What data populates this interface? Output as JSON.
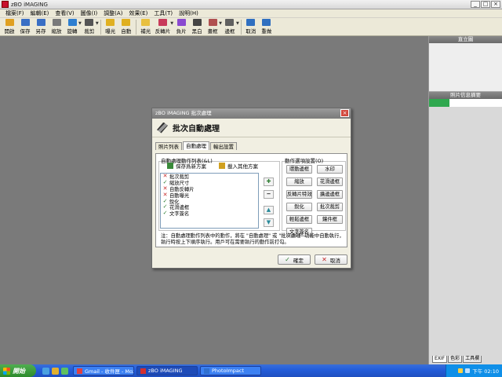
{
  "app": {
    "title": "zBO iMAGING",
    "window_buttons": [
      "_",
      "□",
      "×"
    ]
  },
  "menu": [
    "檔案(F)",
    "編輯(E)",
    "查看(V)",
    "圖像(I)",
    "調整(A)",
    "效果(E)",
    "工具(T)",
    "說明(H)"
  ],
  "toolbar": [
    {
      "label": "開啟",
      "icon": "folder-open-icon",
      "color": "#e0a020"
    },
    {
      "label": "保存",
      "icon": "save-icon",
      "color": "#3a6fc4"
    },
    {
      "label": "另存",
      "icon": "save-as-icon",
      "color": "#3a6fc4"
    },
    {
      "label": "縮放",
      "icon": "zoom-icon",
      "color": "#7a7a7a"
    },
    {
      "label": "旋轉",
      "icon": "rotate-icon",
      "color": "#2f7fd0",
      "dropdown": true
    },
    {
      "label": "裁剪",
      "icon": "crop-icon",
      "color": "#555555",
      "dropdown": true
    },
    {
      "label": "曝光",
      "icon": "exposure-icon",
      "color": "#e0b020"
    },
    {
      "label": "自動",
      "icon": "auto-icon",
      "color": "#e0b020"
    },
    {
      "label": "補光",
      "icon": "fill-light-icon",
      "color": "#e8c040"
    },
    {
      "label": "反轉片",
      "icon": "slide-film-icon",
      "color": "#c83a5a",
      "dropdown": true
    },
    {
      "label": "負片",
      "icon": "negative-icon",
      "color": "#8a4ad0"
    },
    {
      "label": "黑白",
      "icon": "black-white-icon",
      "color": "#444444"
    },
    {
      "label": "畫框",
      "icon": "frame-icon",
      "color": "#b05050",
      "dropdown": true
    },
    {
      "label": "邊框",
      "icon": "border-icon",
      "color": "#606060",
      "dropdown": true
    },
    {
      "label": "取消",
      "icon": "undo-icon",
      "color": "#2f6fc0"
    },
    {
      "label": "重做",
      "icon": "redo-icon",
      "color": "#2f6fc0"
    }
  ],
  "right_panel": {
    "histogram_title": "直立圖",
    "info_title": "照片信息摘要",
    "tabs": [
      "EXIF",
      "色彩",
      "工具欄"
    ]
  },
  "dialog": {
    "title": "zBO iMAGING 批次處理",
    "heading": "批次自動處理",
    "tabs": [
      "照片列表",
      "自動處理",
      "輸出設置"
    ],
    "active_tab_index": 1,
    "list_group_label": "自動處理動作列表(&L)",
    "save_scheme": "保存爲新方案",
    "load_scheme": "載入其他方案",
    "actions_list": [
      {
        "label": "批次裁剪",
        "enabled": false
      },
      {
        "label": "縮放尺寸",
        "enabled": true
      },
      {
        "label": "自動反轉片",
        "enabled": false
      },
      {
        "label": "自動曝光",
        "enabled": false
      },
      {
        "label": "銳化",
        "enabled": true
      },
      {
        "label": "花滑邊框",
        "enabled": true
      },
      {
        "label": "文字簽名",
        "enabled": true
      }
    ],
    "side_buttons": [
      "✚",
      "━",
      "▲",
      "▼"
    ],
    "options_group_label": "動作選項設置(O)",
    "option_buttons": [
      "環動邊框",
      "水印",
      "縮放",
      "花滑邊框",
      "反轉片特效",
      "擴邊邊框",
      "銳化",
      "批次裁剪",
      "輕鬆邊框",
      "鑲件框",
      "文字簽名"
    ],
    "note": "注：自動處理動作列表中的動作，將在 \"自動處理\" 或 \"批次處理\" 功能中自動執行，執行時按上下順序執行。用戶可在需要執行的動作前打勾。",
    "ok_label": "確定",
    "cancel_label": "取消"
  },
  "taskbar": {
    "start_label": "開始",
    "tasks": [
      {
        "label": "Gmail - 收件匣 - Mozi...",
        "active": false,
        "icon_color": "#e04040"
      },
      {
        "label": "zBO iMAGING",
        "active": true,
        "icon_color": "#d32f2f"
      },
      {
        "label": "PhotoImpact",
        "active": false,
        "icon_color": "#3070d0"
      }
    ],
    "clock": "下午 02:10"
  }
}
